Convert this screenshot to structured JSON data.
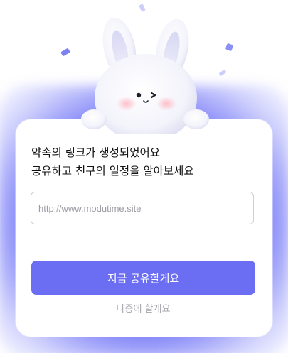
{
  "dialog": {
    "title_line1": "약속의 링크가 생성되었어요",
    "title_line2": "공유하고 친구의 일정을 알아보세요",
    "link_input": {
      "value": "",
      "placeholder": "http://www.modutime.site"
    },
    "share_button_label": "지금 공유할게요",
    "later_button_label": "나중에 할게요"
  },
  "mascot": {
    "icon": "bunny-mascot-icon"
  },
  "colors": {
    "accent": "#6b6ef2",
    "glow": "#6266f6",
    "secondary_text": "#a4a4ab",
    "title_text": "#111111"
  }
}
